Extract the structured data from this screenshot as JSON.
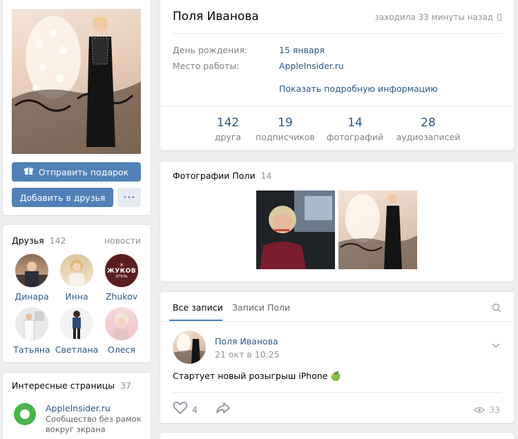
{
  "profile": {
    "name": "Поля Иванова",
    "last_seen": "заходила 33 минуты назад",
    "birthday_label": "День рождения:",
    "birthday_value": "15 января",
    "work_label": "Место работы:",
    "work_value": "AppleInsider.ru",
    "more_info": "Показать подробную информацию"
  },
  "stats": [
    {
      "num": "142",
      "label": "друга"
    },
    {
      "num": "19",
      "label": "подписчиков"
    },
    {
      "num": "14",
      "label": "фотографий"
    },
    {
      "num": "28",
      "label": "аудиозаписей"
    }
  ],
  "actions": {
    "gift": "Отправить подарок",
    "add_friend": "Добавить в друзья",
    "more": "•••"
  },
  "friends": {
    "title": "Друзья",
    "count": "142",
    "news": "новости",
    "items": [
      {
        "name": "Динара"
      },
      {
        "name": "Инна"
      },
      {
        "name": "Zhukov",
        "logo_main": "ЖУКОВ",
        "logo_sub": "ОТЕЛЬ"
      },
      {
        "name": "Татьяна"
      },
      {
        "name": "Светлана"
      },
      {
        "name": "Олеся"
      }
    ]
  },
  "pages": {
    "title": "Интересные страницы",
    "count": "37",
    "item_name": "AppleInsider.ru",
    "item_desc": "Сообщество без рамок вокруг экрана"
  },
  "photos": {
    "title": "Фотографии Поли",
    "count": "14"
  },
  "wall": {
    "tab_all": "Все записи",
    "tab_own": "Записи Поли",
    "post_author": "Поля Иванова",
    "post_time": "21 окт в 10:25",
    "post_text": "Стартует новый розыгрыш iPhone 🍏",
    "likes": "4",
    "views": "33"
  },
  "colors": {
    "link": "#2a5885",
    "button": "#5181b8",
    "background": "#edeef0"
  }
}
